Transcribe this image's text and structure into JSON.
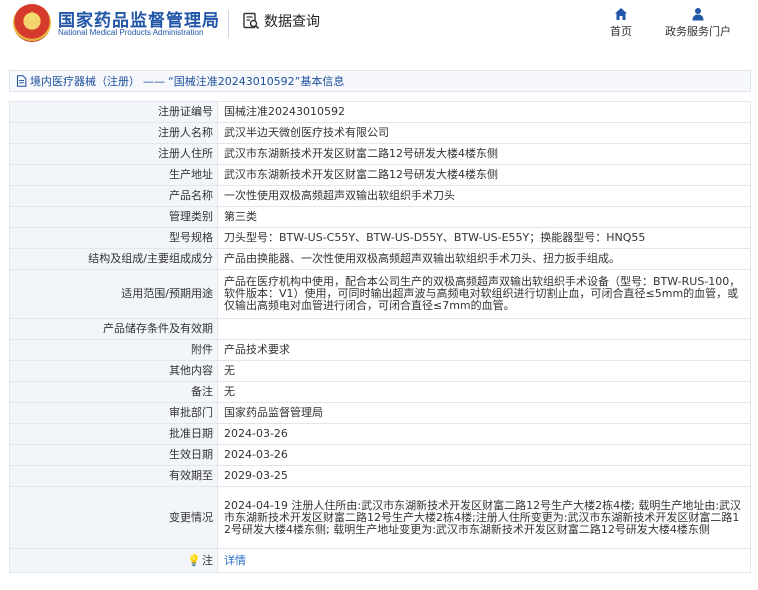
{
  "header": {
    "site_title": "国家药品监督管理局",
    "site_subtitle": "National Medical Products Administration",
    "search_label": "数据查询",
    "nav": {
      "home_label": "首页",
      "portal_label": "政务服务门户"
    }
  },
  "breadcrumb": {
    "category_link": "境内医疗器械（注册）",
    "separator": "——",
    "page_title": "“国械注准20243010592”基本信息"
  },
  "records": [
    {
      "label": "注册证编号",
      "value": "国械注准20243010592"
    },
    {
      "label": "注册人名称",
      "value": "武汉半边天微创医疗技术有限公司"
    },
    {
      "label": "注册人住所",
      "value": "武汉市东湖新技术开发区财富二路12号研发大楼4楼东侧"
    },
    {
      "label": "生产地址",
      "value": "武汉市东湖新技术开发区财富二路12号研发大楼4楼东侧"
    },
    {
      "label": "产品名称",
      "value": "一次性使用双极高频超声双输出软组织手术刀头"
    },
    {
      "label": "管理类别",
      "value": "第三类"
    },
    {
      "label": "型号规格",
      "value": "刀头型号：BTW-US-C55Y、BTW-US-D55Y、BTW-US-E55Y；换能器型号：HNQ55"
    },
    {
      "label": "结构及组成/主要组成成分",
      "value": "产品由换能器、一次性使用双极高频超声双输出软组织手术刀头、扭力扳手组成。"
    },
    {
      "label": "适用范围/预期用途",
      "value": "产品在医疗机构中使用，配合本公司生产的双极高频超声双输出软组织手术设备（型号：BTW-RUS-100，软件版本：V1）使用，可同时输出超声波与高频电对软组织进行切割止血，可闭合直径≤5mm的血管，或仅输出高频电对血管进行闭合，可闭合直径≤7mm的血管。"
    },
    {
      "label": "产品储存条件及有效期",
      "value": ""
    },
    {
      "label": "附件",
      "value": "产品技术要求"
    },
    {
      "label": "其他内容",
      "value": "无"
    },
    {
      "label": "备注",
      "value": "无"
    },
    {
      "label": "审批部门",
      "value": "国家药品监督管理局"
    },
    {
      "label": "批准日期",
      "value": "2024-03-26"
    },
    {
      "label": "生效日期",
      "value": "2024-03-26"
    },
    {
      "label": "有效期至",
      "value": "2029-03-25"
    },
    {
      "label": "变更情况",
      "value": "2024-04-19 注册人住所由:武汉市东湖新技术开发区财富二路12号生产大楼2栋4楼; 载明生产地址由:武汉市东湖新技术开发区财富二路12号生产大楼2栋4楼;注册人住所变更为:武汉市东湖新技术开发区财富二路12号研发大楼4楼东侧; 载明生产地址变更为:武汉市东湖新技术开发区财富二路12号研发大楼4楼东侧"
    }
  ],
  "note": {
    "label": "注",
    "link_label": "详情"
  }
}
